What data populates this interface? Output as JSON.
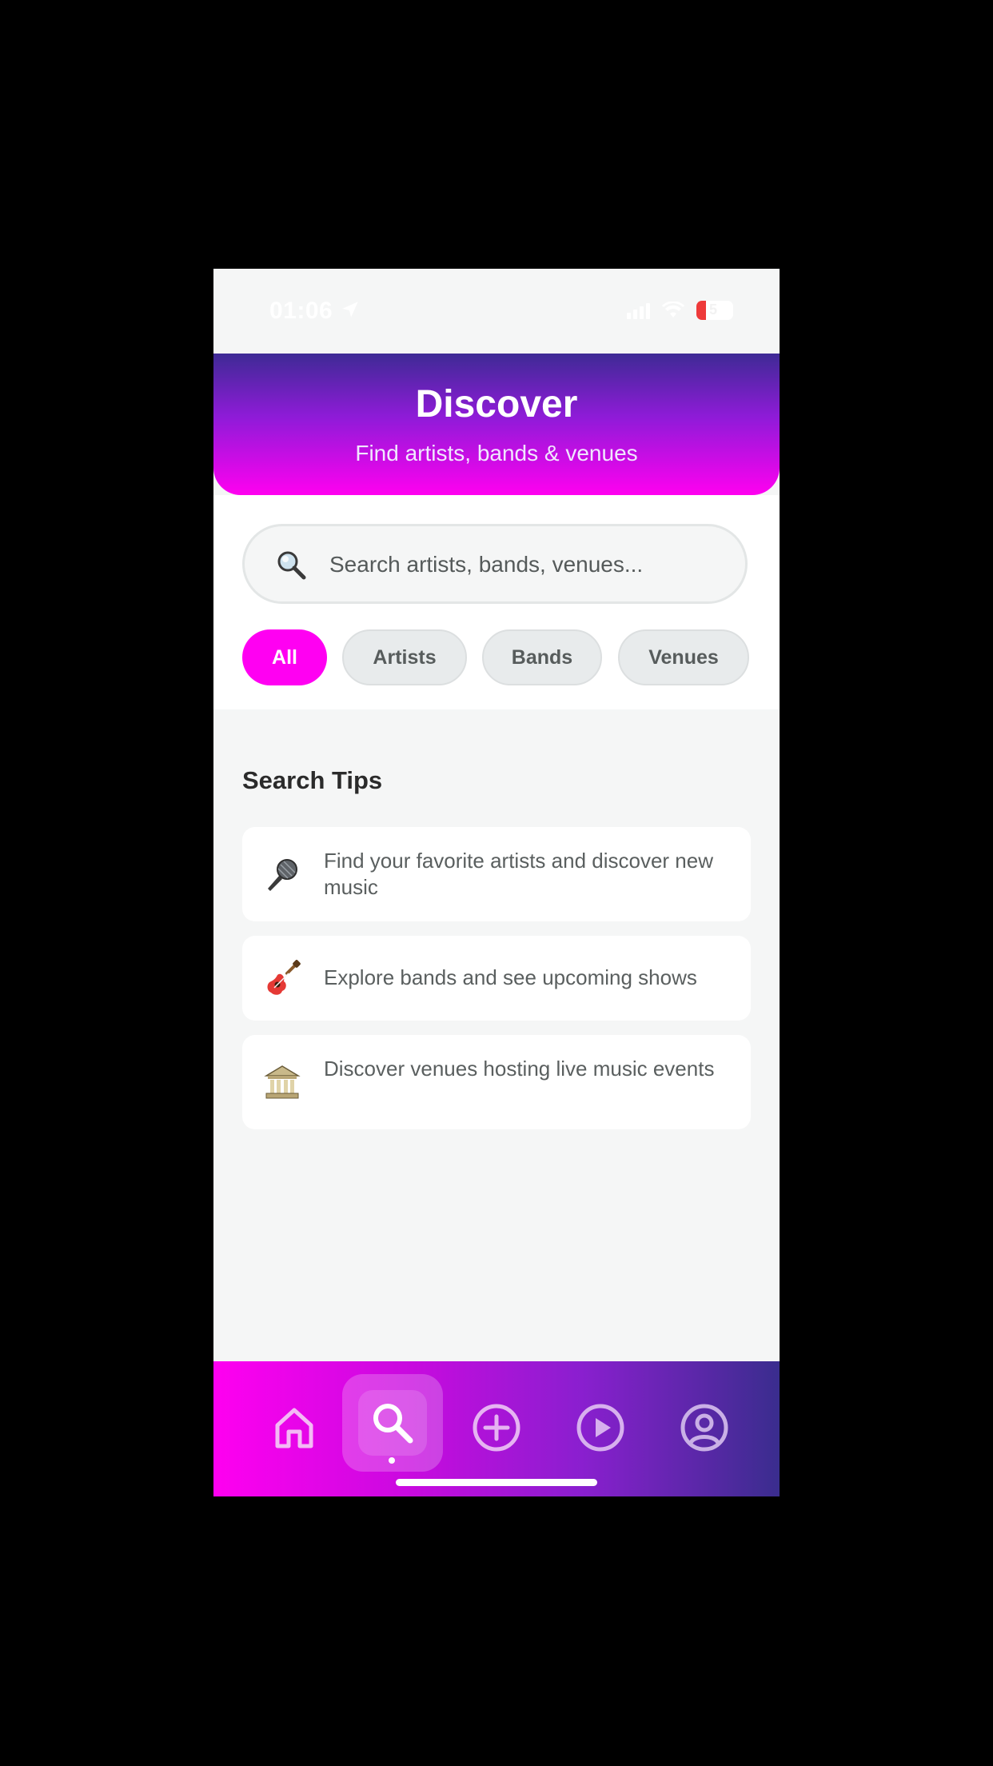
{
  "status_bar": {
    "time": "01:06",
    "battery": "5"
  },
  "header": {
    "title": "Discover",
    "subtitle": "Find artists, bands & venues"
  },
  "search": {
    "placeholder": "Search artists, bands, venues..."
  },
  "filters": [
    {
      "label": "All",
      "active": true
    },
    {
      "label": "Artists",
      "active": false
    },
    {
      "label": "Bands",
      "active": false
    },
    {
      "label": "Venues",
      "active": false
    }
  ],
  "tips": {
    "title": "Search Tips",
    "items": [
      {
        "icon": "microphone-icon",
        "text": "Find your favorite artists and discover new music"
      },
      {
        "icon": "guitar-icon",
        "text": "Explore bands and see upcoming shows"
      },
      {
        "icon": "venue-building-icon",
        "text": "Discover venues hosting live music events"
      }
    ]
  },
  "bottom_nav": {
    "items": [
      {
        "icon": "home-icon",
        "active": false
      },
      {
        "icon": "search-icon",
        "active": true
      },
      {
        "icon": "add-circle-icon",
        "active": false
      },
      {
        "icon": "play-circle-icon",
        "active": false
      },
      {
        "icon": "profile-icon",
        "active": false
      }
    ]
  },
  "colors": {
    "accent": "#ff00f2",
    "header_top": "#3e2a95",
    "header_bottom": "#ff00f0",
    "nav_left": "#ff00f0",
    "nav_right": "#3a2d8e"
  }
}
